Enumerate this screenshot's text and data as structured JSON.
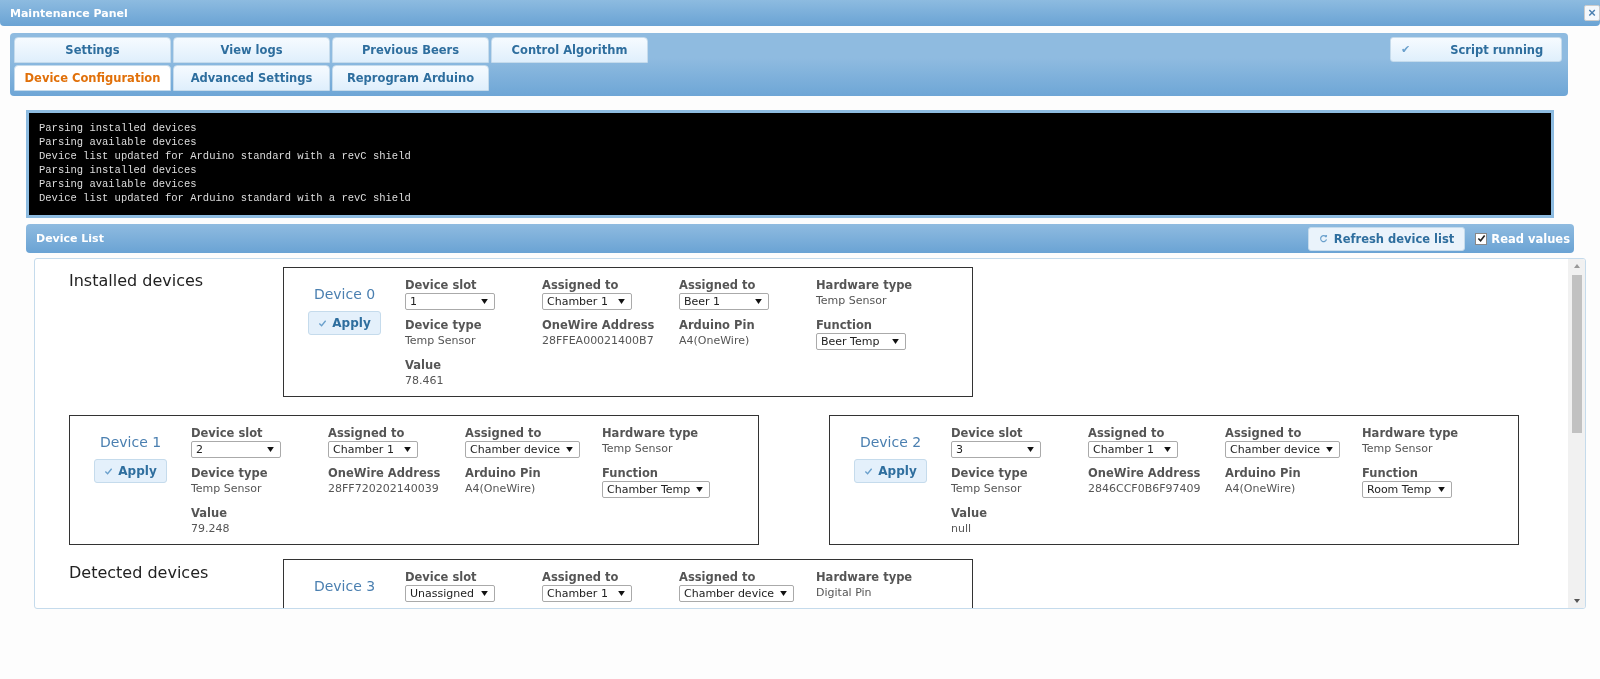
{
  "window": {
    "title": "Maintenance Panel",
    "close": "×"
  },
  "tabs": [
    [
      {
        "label": "Settings",
        "selected": false
      },
      {
        "label": "View logs",
        "selected": false
      },
      {
        "label": "Previous Beers",
        "selected": false
      },
      {
        "label": "Control Algorithm",
        "selected": false
      }
    ],
    [
      {
        "label": "Device Configuration",
        "selected": true
      },
      {
        "label": "Advanced Settings",
        "selected": false
      },
      {
        "label": "Reprogram Arduino",
        "selected": false
      }
    ]
  ],
  "status_button": {
    "icon": "✔",
    "label": "Script running"
  },
  "console": [
    "Parsing installed devices",
    "Parsing available devices",
    "Device list updated for Arduino standard with a revC shield",
    "Parsing installed devices",
    "Parsing available devices",
    "Device list updated for Arduino standard with a revC shield"
  ],
  "device_list": {
    "title": "Device List",
    "refresh_button": "Refresh device list",
    "read_values": {
      "label": "Read values",
      "checked": true
    }
  },
  "sections": [
    {
      "title": "Installed devices",
      "devices": [
        {
          "title": "Device 0",
          "apply": "Apply",
          "fields": [
            {
              "label": "Device slot",
              "value": "1",
              "kind": "select"
            },
            {
              "label": "Assigned to",
              "value": "Chamber 1",
              "kind": "select"
            },
            {
              "label": "Assigned to",
              "value": "Beer 1",
              "kind": "select"
            },
            {
              "label": "Hardware type",
              "value": "Temp Sensor",
              "kind": "text"
            },
            {
              "label": "Device type",
              "value": "Temp Sensor",
              "kind": "text"
            },
            {
              "label": "OneWire Address",
              "value": "28FFEA00021400B7",
              "kind": "text"
            },
            {
              "label": "Arduino Pin",
              "value": "A4(OneWire)",
              "kind": "text"
            },
            {
              "label": "Function",
              "value": "Beer Temp",
              "kind": "select"
            },
            {
              "label": "Value",
              "value": "78.461",
              "kind": "text"
            }
          ]
        },
        {
          "title": "Device 1",
          "apply": "Apply",
          "fields": [
            {
              "label": "Device slot",
              "value": "2",
              "kind": "select"
            },
            {
              "label": "Assigned to",
              "value": "Chamber 1",
              "kind": "select"
            },
            {
              "label": "Assigned to",
              "value": "Chamber device",
              "kind": "select"
            },
            {
              "label": "Hardware type",
              "value": "Temp Sensor",
              "kind": "text"
            },
            {
              "label": "Device type",
              "value": "Temp Sensor",
              "kind": "text"
            },
            {
              "label": "OneWire Address",
              "value": "28FF720202140039",
              "kind": "text"
            },
            {
              "label": "Arduino Pin",
              "value": "A4(OneWire)",
              "kind": "text"
            },
            {
              "label": "Function",
              "value": "Chamber Temp",
              "kind": "select"
            },
            {
              "label": "Value",
              "value": "79.248",
              "kind": "text"
            }
          ]
        },
        {
          "title": "Device 2",
          "apply": "Apply",
          "fields": [
            {
              "label": "Device slot",
              "value": "3",
              "kind": "select"
            },
            {
              "label": "Assigned to",
              "value": "Chamber 1",
              "kind": "select"
            },
            {
              "label": "Assigned to",
              "value": "Chamber device",
              "kind": "select"
            },
            {
              "label": "Hardware type",
              "value": "Temp Sensor",
              "kind": "text"
            },
            {
              "label": "Device type",
              "value": "Temp Sensor",
              "kind": "text"
            },
            {
              "label": "OneWire Address",
              "value": "2846CCF0B6F97409",
              "kind": "text"
            },
            {
              "label": "Arduino Pin",
              "value": "A4(OneWire)",
              "kind": "text"
            },
            {
              "label": "Function",
              "value": "Room Temp",
              "kind": "select"
            },
            {
              "label": "Value",
              "value": "null",
              "kind": "text"
            }
          ]
        }
      ]
    },
    {
      "title": "Detected devices",
      "devices": [
        {
          "title": "Device 3",
          "fields": [
            {
              "label": "Device slot",
              "value": "Unassigned",
              "kind": "select"
            },
            {
              "label": "Assigned to",
              "value": "Chamber 1",
              "kind": "select"
            },
            {
              "label": "Assigned to",
              "value": "Chamber device",
              "kind": "select"
            },
            {
              "label": "Hardware type",
              "value": "Digital Pin",
              "kind": "text"
            }
          ]
        }
      ]
    }
  ]
}
